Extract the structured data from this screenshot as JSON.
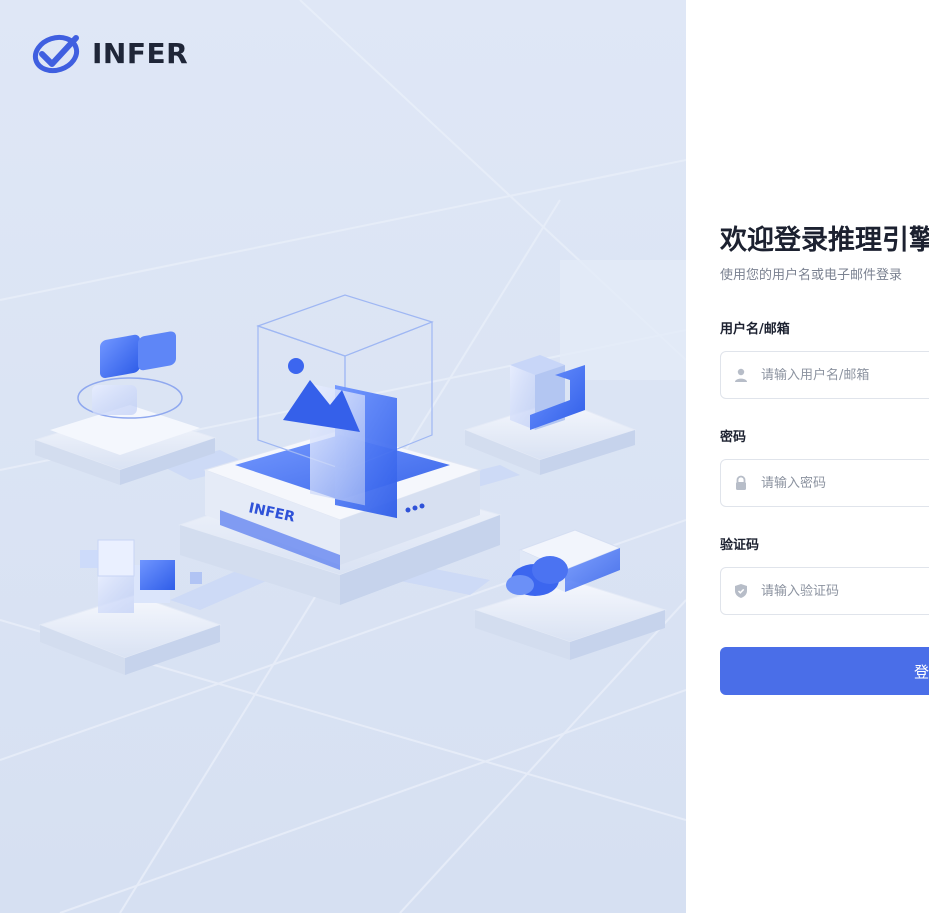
{
  "brand": {
    "logo_text": "INFER",
    "accent_color": "#4a6ee8",
    "title_color": "#1c2130"
  },
  "illustration": {
    "center_block_label": "INFER",
    "icons": [
      "puzzle-icon",
      "image-frame-icon",
      "cube-icon",
      "blocks-icon",
      "cloud-server-icon"
    ]
  },
  "login": {
    "title": "欢迎登录推理引擎",
    "subtitle": "使用您的用户名或电子邮件登录",
    "username": {
      "label": "用户名/邮箱",
      "placeholder": "请输入用户名/邮箱",
      "icon": "user-icon",
      "value": ""
    },
    "password": {
      "label": "密码",
      "placeholder": "请输入密码",
      "icon": "lock-icon",
      "value": ""
    },
    "captcha": {
      "label": "验证码",
      "placeholder": "请输入验证码",
      "icon": "shield-icon",
      "value": ""
    },
    "submit_label": "登录"
  }
}
